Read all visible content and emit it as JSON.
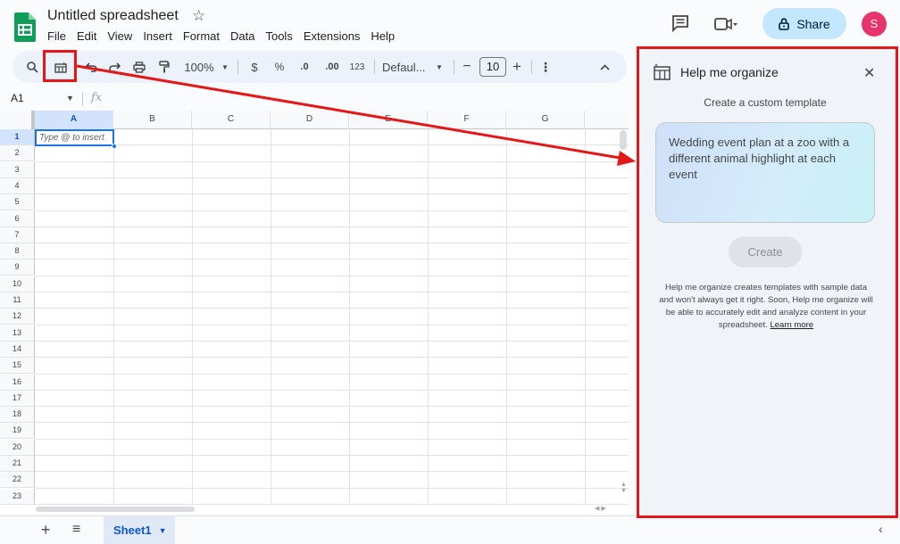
{
  "doc": {
    "title": "Untitled spreadsheet"
  },
  "menu": [
    "File",
    "Edit",
    "View",
    "Insert",
    "Format",
    "Data",
    "Tools",
    "Extensions",
    "Help"
  ],
  "header": {
    "share_label": "Share",
    "avatar_initial": "S"
  },
  "toolbar": {
    "zoom": "100%",
    "currency": "$",
    "percent": "%",
    "decrease_decimal": ".0",
    "increase_decimal": ".00",
    "number_format": "123",
    "font": "Defaul...",
    "font_size": "10",
    "minus": "−",
    "plus": "+"
  },
  "formula": {
    "cell_ref": "A1",
    "fx": "fx"
  },
  "grid": {
    "columns": [
      "A",
      "B",
      "C",
      "D",
      "E",
      "F",
      "G"
    ],
    "rows": [
      "1",
      "2",
      "3",
      "4",
      "5",
      "6",
      "7",
      "8",
      "9",
      "10",
      "11",
      "12",
      "13",
      "14",
      "15",
      "16",
      "17",
      "18",
      "19",
      "20",
      "21",
      "22",
      "23"
    ],
    "active_cell_placeholder": "Type @ to insert"
  },
  "sheets": {
    "active": "Sheet1"
  },
  "panel": {
    "title": "Help me organize",
    "subtitle": "Create a custom template",
    "prompt_text": "Wedding event plan at a zoo with a different animal highlight at each event",
    "create_label": "Create",
    "disclaimer": "Help me organize creates templates with sample data and won't always get it right. Soon, Help me organize will be able to accurately edit and analyze content in your spreadsheet.",
    "learn_more": "Learn more"
  },
  "colors": {
    "annotation": "#e51616",
    "accent": "#0b57d0",
    "share_bg": "#c2e7ff",
    "avatar": "#e8336d"
  }
}
